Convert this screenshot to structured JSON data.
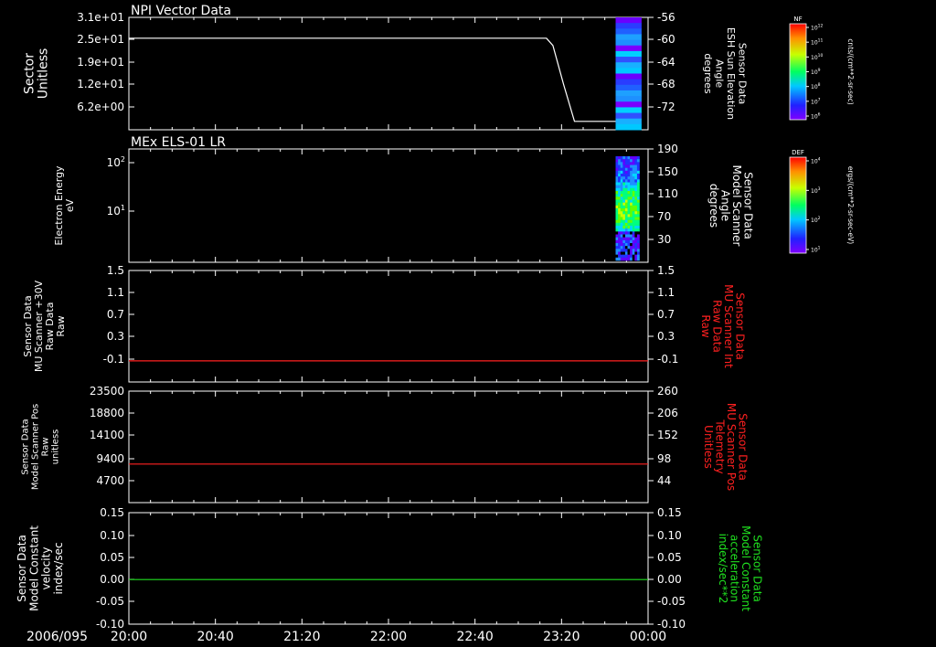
{
  "date_label": "2006/095",
  "time_ticks": [
    "20:00",
    "20:40",
    "21:20",
    "22:00",
    "22:40",
    "23:20",
    "00:00"
  ],
  "chart_data": [
    {
      "type": "line+heatmap",
      "title": "NPI Vector Data",
      "left_axis": {
        "label_lines": [
          "Sector",
          "Unitless"
        ],
        "ticks": [
          "3.1e+01",
          "2.5e+01",
          "1.9e+01",
          "1.2e+01",
          "6.2e+00"
        ],
        "ylim": [
          0,
          31
        ]
      },
      "right_axis": {
        "label_lines": [
          "Sensor Data",
          "ESH Sun Elevation",
          "Angle",
          "degrees"
        ],
        "ticks": [
          "-56",
          "-60",
          "-64",
          "-68",
          "-72"
        ],
        "ylim": [
          -76,
          -56
        ]
      },
      "colorbar": {
        "name": "NF",
        "unit": "cnts/(cm**2-sr-sec)",
        "ticks": [
          "10^12",
          "10^11",
          "10^10",
          "10^9",
          "10^8",
          "10^7",
          "10^6"
        ]
      },
      "series": [
        {
          "x": [
            "20:00",
            "23:13",
            "23:16",
            "23:21",
            "23:26",
            "23:45"
          ],
          "y": [
            -59.7,
            -59.7,
            -61,
            -68,
            -74.5,
            -74.5
          ],
          "color": "#ffffff"
        }
      ],
      "heatmap_x_range": [
        "23:45",
        "23:57"
      ]
    },
    {
      "type": "heatmap",
      "title": "MEx ELS-01 LR",
      "left_axis": {
        "label_lines": [
          "Electron Energy",
          "eV"
        ],
        "log": true,
        "ticks": [
          "10^2",
          "10^1"
        ]
      },
      "right_axis": {
        "label_lines": [
          "Sensor Data",
          "Model Scanner",
          "Angle",
          "degrees"
        ],
        "ticks": [
          "190",
          "150",
          "110",
          "70",
          "30"
        ],
        "ylim": [
          0,
          190
        ]
      },
      "colorbar": {
        "name": "DEF",
        "unit": "ergs/(cm**2-sr-sec-eV)",
        "ticks": [
          "10^4",
          "10^3",
          "10^2",
          "10^1"
        ]
      },
      "heatmap_x_range": [
        "23:45",
        "23:56"
      ]
    },
    {
      "type": "line",
      "left_axis": {
        "label_lines": [
          "Sensor Data",
          "MU Scanner +30V",
          "Raw Data",
          "Raw"
        ],
        "ticks": [
          "1.5",
          "1.1",
          "0.7",
          "0.3",
          "-0.1"
        ],
        "ylim": [
          -0.35,
          1.5
        ]
      },
      "right_axis": {
        "label_lines": [
          "Sensor Data",
          "MU Scanner Int",
          "Raw Data",
          "Raw"
        ],
        "ticks": [
          "1.5",
          "1.1",
          "0.7",
          "0.3",
          "-0.1"
        ],
        "ylim": [
          -0.35,
          1.5
        ],
        "color": "#ff2020"
      },
      "series": [
        {
          "x": [
            "20:00",
            "00:00"
          ],
          "y": [
            0,
            0
          ],
          "color": "#ff2020"
        }
      ]
    },
    {
      "type": "line",
      "left_axis": {
        "label_lines": [
          "Sensor Data",
          "Model Scanner Pos",
          "Raw",
          "unitless"
        ],
        "ticks": [
          "23500",
          "18800",
          "14100",
          "9400",
          "4700"
        ],
        "ylim": [
          0,
          23500
        ]
      },
      "right_axis": {
        "label_lines": [
          "Sensor Data",
          "MU Scanner Pos",
          "Telemetry",
          "Unitless"
        ],
        "ticks": [
          "260",
          "206",
          "152",
          "98",
          "44"
        ],
        "ylim": [
          0,
          260
        ],
        "color": "#ff2020"
      },
      "series": [
        {
          "x": [
            "20:00",
            "00:00"
          ],
          "y": [
            90,
            90
          ],
          "color": "#ff2020"
        }
      ]
    },
    {
      "type": "line",
      "left_axis": {
        "label_lines": [
          "Sensor Data",
          "Model Constant",
          "velocity",
          "index/sec"
        ],
        "ticks": [
          "0.15",
          "0.10",
          "0.05",
          "0.00",
          "-0.05",
          "-0.10"
        ],
        "ylim": [
          -0.1,
          0.15
        ]
      },
      "right_axis": {
        "label_lines": [
          "Sensor Data",
          "Model Constant",
          "acceleration",
          "index/sec**2"
        ],
        "ticks": [
          "0.15",
          "0.10",
          "0.05",
          "0.00",
          "-0.05",
          "-0.10"
        ],
        "ylim": [
          -0.1,
          0.15
        ],
        "color": "#20e020"
      },
      "series": [
        {
          "x": [
            "20:00",
            "00:00"
          ],
          "y": [
            0,
            0
          ],
          "color": "#20e020"
        }
      ]
    }
  ]
}
